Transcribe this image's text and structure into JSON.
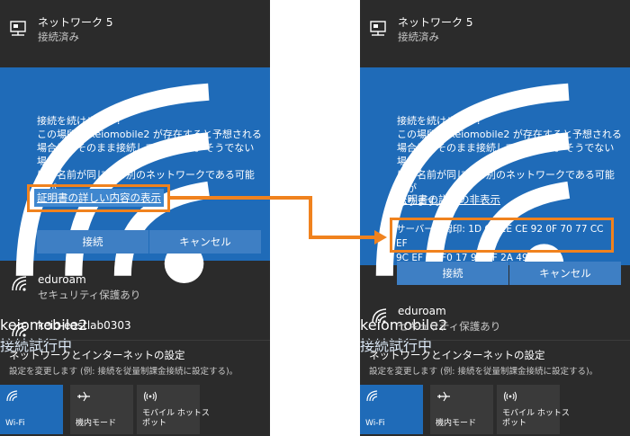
{
  "left": {
    "network5": {
      "name": "ネットワーク 5",
      "status": "接続済み"
    },
    "conn": {
      "name": "keiomobile2",
      "status": "接続試行中"
    },
    "message": {
      "line1": "接続を続けますか?",
      "line2": "この場所に keiomobile2 が存在すると予想される",
      "line3": "場合は、そのまま接続してください。そうでない場合",
      "line4": "は、名前が同じでも別のネットワークである可能性が",
      "line5": "あります。"
    },
    "details_link": "証明書の詳しい内容の表示",
    "connect_label": "接続",
    "cancel_label": "キャンセル",
    "eduroam": {
      "name": "eduroam",
      "status": "セキュリティ保護あり"
    },
    "keio_east": {
      "name": "keio-eastlab0303"
    },
    "settings": {
      "title": "ネットワークとインターネットの設定",
      "desc": "設定を変更します (例: 接続を従量制課金接続に設定する)。"
    },
    "tiles": [
      {
        "label": "Wi-Fi",
        "icon": "wifi-icon"
      },
      {
        "label": "機内モード",
        "icon": "airplane-icon"
      },
      {
        "label_line1": "モバイル ホットス",
        "label_line2": "ポット",
        "icon": "hotspot-icon"
      }
    ]
  },
  "right": {
    "network5": {
      "name": "ネットワーク 5",
      "status": "接続済み"
    },
    "conn": {
      "name": "keiomobile2",
      "status": "接続試行中"
    },
    "message": {
      "line1": "接続を続けますか?",
      "line2": "この場所に keiomobile2 が存在すると予想される",
      "line3": "場合は、そのまま接続してください。そうでない場合",
      "line4": "は、名前が同じでも別のネットワークである可能性が",
      "line5": "あります。"
    },
    "hide_link": "証明書の詳細の非表示",
    "fingerprint_line1": "サーバーの拇印: 1D C9 1E CE 92 0F 70 77 CC EF",
    "fingerprint_line2": "9C EF 40 F0 17 99 AF 2A 49 B0",
    "connect_label": "接続",
    "cancel_label": "キャンセル",
    "eduroam": {
      "name": "eduroam",
      "status": "セキュリティ保護あり"
    },
    "settings": {
      "title": "ネットワークとインターネットの設定",
      "desc": "設定を変更します (例: 接続を従量制課金接続に設定する)。"
    },
    "tiles": [
      {
        "label": "Wi-Fi",
        "icon": "wifi-icon"
      },
      {
        "label": "機内モード",
        "icon": "airplane-icon"
      },
      {
        "label_line1": "モバイル ホットス",
        "label_line2": "ポット",
        "icon": "hotspot-icon"
      }
    ]
  },
  "colors": {
    "accent": "#1f6bb8",
    "highlight": "#f0821e",
    "panel": "#2b2b2b"
  }
}
